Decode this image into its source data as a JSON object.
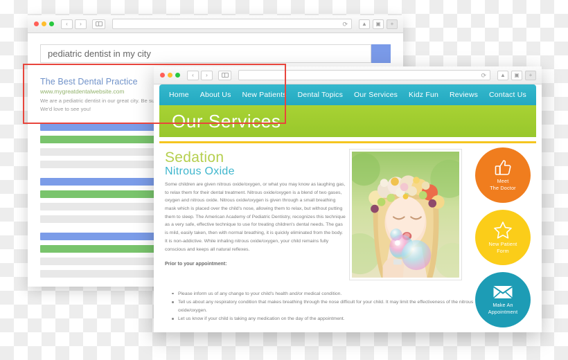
{
  "back_browser": {
    "name": "search-results-browser",
    "traffic_lights": [
      "close",
      "minimize",
      "maximize"
    ],
    "nav": {
      "back": "‹",
      "forward": "›"
    },
    "address_value": "",
    "reload_glyph": "⟳",
    "right_buttons": [
      "share-icon",
      "tabs-icon",
      "new-tab-icon"
    ],
    "search": {
      "value": "pediatric dentist in my city",
      "placeholder": "Search",
      "button_label": ""
    },
    "result": {
      "title": "The Best Dental Practice",
      "url": "www.mygreatdentalwebsite.com",
      "snippet": "We are a pediatric dentist in our great city. Be sure to make an appointment prior to your visit. We'd love to see you!"
    },
    "placeholder_bars": [
      {
        "color": "blue",
        "kind": "title-bar"
      },
      {
        "color": "green",
        "kind": "url-bar"
      },
      {
        "color": "grey",
        "kind": "text-bar"
      },
      {
        "color": "grey",
        "kind": "text-bar"
      },
      {
        "color": "blue",
        "kind": "title-bar"
      },
      {
        "color": "green",
        "kind": "url-bar"
      },
      {
        "color": "grey",
        "kind": "text-bar"
      },
      {
        "color": "grey",
        "kind": "text-bar"
      },
      {
        "color": "blue",
        "kind": "title-bar"
      },
      {
        "color": "green",
        "kind": "url-bar"
      },
      {
        "color": "grey",
        "kind": "text-bar"
      },
      {
        "color": "grey",
        "kind": "text-bar"
      }
    ]
  },
  "front_browser": {
    "name": "dental-site-browser",
    "nav": {
      "back": "‹",
      "forward": "›"
    },
    "address_value": "",
    "reload_glyph": "⟳",
    "site": {
      "nav_items": [
        "Home",
        "About Us",
        "New Patients",
        "Dental Topics",
        "Our Services",
        "Kidz Fun",
        "Reviews",
        "Contact Us"
      ],
      "hero_title": "Our Services",
      "heading_primary": "Sedation",
      "heading_secondary": "Nitrous Oxide",
      "body": "Some children are given nitrous oxide/oxygen, or what you may know as laughing gas, to relax them for their dental treatment. Nitrous oxide/oxygen is a blend of two gases, oxygen and nitrous oxide. Nitrous oxide/oxygen is given through a small breathing mask which is placed over the child's nose, allowing them to relax, but without putting them to sleep. The American Academy of Pediatric Dentistry, recognizes this technique as a very safe, effective technique to use for treating children's dental needs. The gas is mild, easily taken, then with normal breathing, it is quickly eliminated from the body. It is non-addictive. While inhaling nitrous oxide/oxygen, your child remains fully conscious and keeps all natural reflexes.",
      "prior_heading": "Prior to your appointment:",
      "bullets": [
        "Please inform us of any change to your child's health and/or medical condition.",
        "Tell us about any respiratory condition that makes breathing through the nose difficult for your child. It may limit the effectiveness of the nitrous oxide/oxygen.",
        "Let us know if your child is taking any medication on the day of the appointment."
      ],
      "photo_alt": "girl with flower crown blowing bubbles",
      "cta_buttons": [
        {
          "icon": "thumbs-up-icon",
          "label": "Meet\nThe Doctor",
          "color": "#f07d1e"
        },
        {
          "icon": "star-icon",
          "label": "New Patient\nForm",
          "color": "#fbcd19"
        },
        {
          "icon": "envelope-icon",
          "label": "Make An\nAppointment",
          "color": "#1d9cb5"
        }
      ]
    }
  },
  "annotation": {
    "highlight_color": "#e8453c",
    "name": "red-highlight-box"
  }
}
